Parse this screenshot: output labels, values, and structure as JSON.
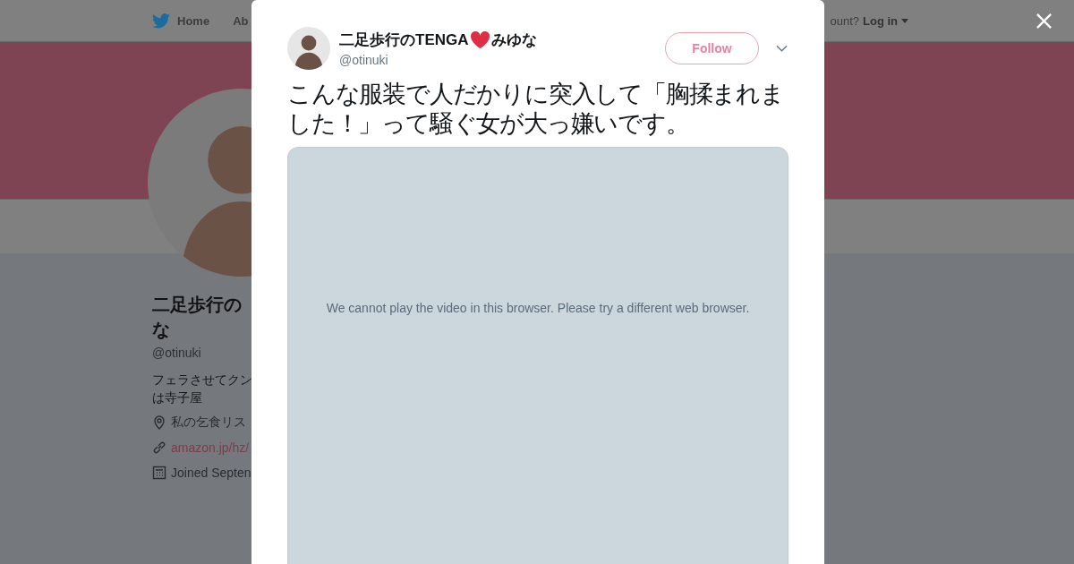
{
  "nav": {
    "items": [
      "Home",
      "Ab"
    ],
    "account_prompt": "ount?",
    "login": "Log in"
  },
  "profile": {
    "name_lines": [
      "二足歩行の",
      "な"
    ],
    "handle": "@otinuki",
    "bio_lines": [
      "フェラさせてクン",
      "は寺子屋"
    ],
    "location": "私の乞食リス",
    "link": "amazon.jp/hz/",
    "joined": "Joined Septen"
  },
  "tweet": {
    "name_before": "二足歩行のTENGA",
    "name_after": "みゆな",
    "handle": "@otinuki",
    "follow": "Follow",
    "text": "こんな服装で人だかりに突入して「胸揉まれました！」って騒ぐ女が大っ嫌いです。",
    "video_message": "We cannot play the video in this browser. Please try a different web browser."
  }
}
